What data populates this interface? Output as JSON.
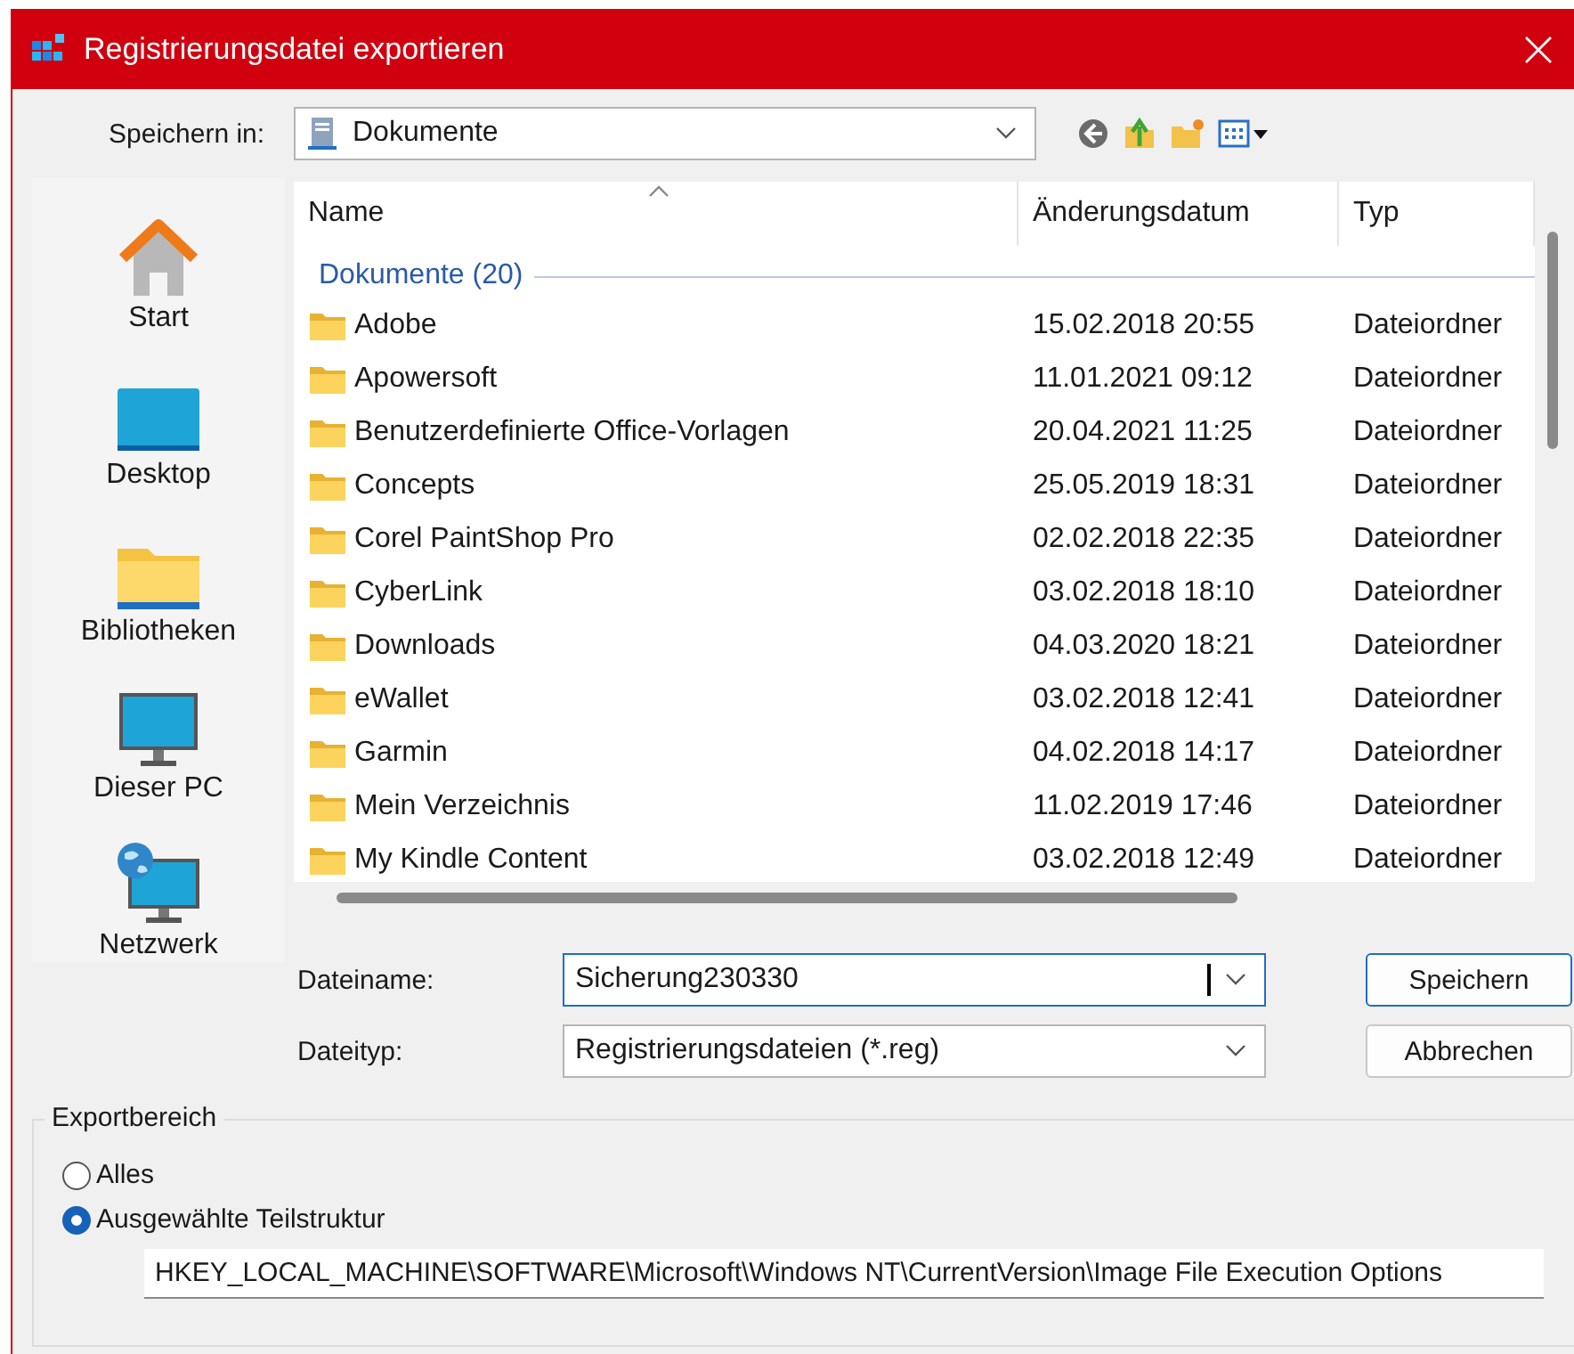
{
  "window": {
    "title": "Registrierungsdatei exportieren"
  },
  "save_in": {
    "label": "Speichern in:",
    "value": "Dokumente"
  },
  "places": [
    {
      "label": "Start",
      "kind": "home"
    },
    {
      "label": "Desktop",
      "kind": "desktop"
    },
    {
      "label": "Bibliotheken",
      "kind": "library"
    },
    {
      "label": "Dieser PC",
      "kind": "pc"
    },
    {
      "label": "Netzwerk",
      "kind": "network"
    }
  ],
  "file_list": {
    "columns": [
      "Name",
      "Änderungsdatum",
      "Typ"
    ],
    "group": "Dokumente (20)",
    "rows": [
      {
        "name": "Adobe",
        "date": "15.02.2018 20:55",
        "type": "Dateiordner"
      },
      {
        "name": "Apowersoft",
        "date": "11.01.2021 09:12",
        "type": "Dateiordner"
      },
      {
        "name": "Benutzerdefinierte Office-Vorlagen",
        "date": "20.04.2021 11:25",
        "type": "Dateiordner"
      },
      {
        "name": "Concepts",
        "date": "25.05.2019 18:31",
        "type": "Dateiordner"
      },
      {
        "name": "Corel PaintShop Pro",
        "date": "02.02.2018 22:35",
        "type": "Dateiordner"
      },
      {
        "name": "CyberLink",
        "date": "03.02.2018 18:10",
        "type": "Dateiordner"
      },
      {
        "name": "Downloads",
        "date": "04.03.2020 18:21",
        "type": "Dateiordner"
      },
      {
        "name": "eWallet",
        "date": "03.02.2018 12:41",
        "type": "Dateiordner"
      },
      {
        "name": "Garmin",
        "date": "04.02.2018 14:17",
        "type": "Dateiordner"
      },
      {
        "name": "Mein Verzeichnis",
        "date": "11.02.2019 17:46",
        "type": "Dateiordner"
      },
      {
        "name": "My Kindle Content",
        "date": "03.02.2018 12:49",
        "type": "Dateiordner"
      }
    ]
  },
  "file_name": {
    "label": "Dateiname:",
    "value": "Sicherung230330"
  },
  "file_type": {
    "label": "Dateityp:",
    "value": "Registrierungsdateien (*.reg)"
  },
  "buttons": [
    {
      "label": "Speichern",
      "default": true
    },
    {
      "label": "Abbrechen",
      "default": false
    }
  ],
  "export_range": {
    "title": "Exportbereich",
    "options": [
      {
        "label": "Alles",
        "selected": false
      },
      {
        "label": "Ausgewählte Teilstruktur",
        "selected": true
      }
    ],
    "branch": "HKEY_LOCAL_MACHINE\\SOFTWARE\\Microsoft\\Windows NT\\CurrentVersion\\Image File Execution Options"
  }
}
